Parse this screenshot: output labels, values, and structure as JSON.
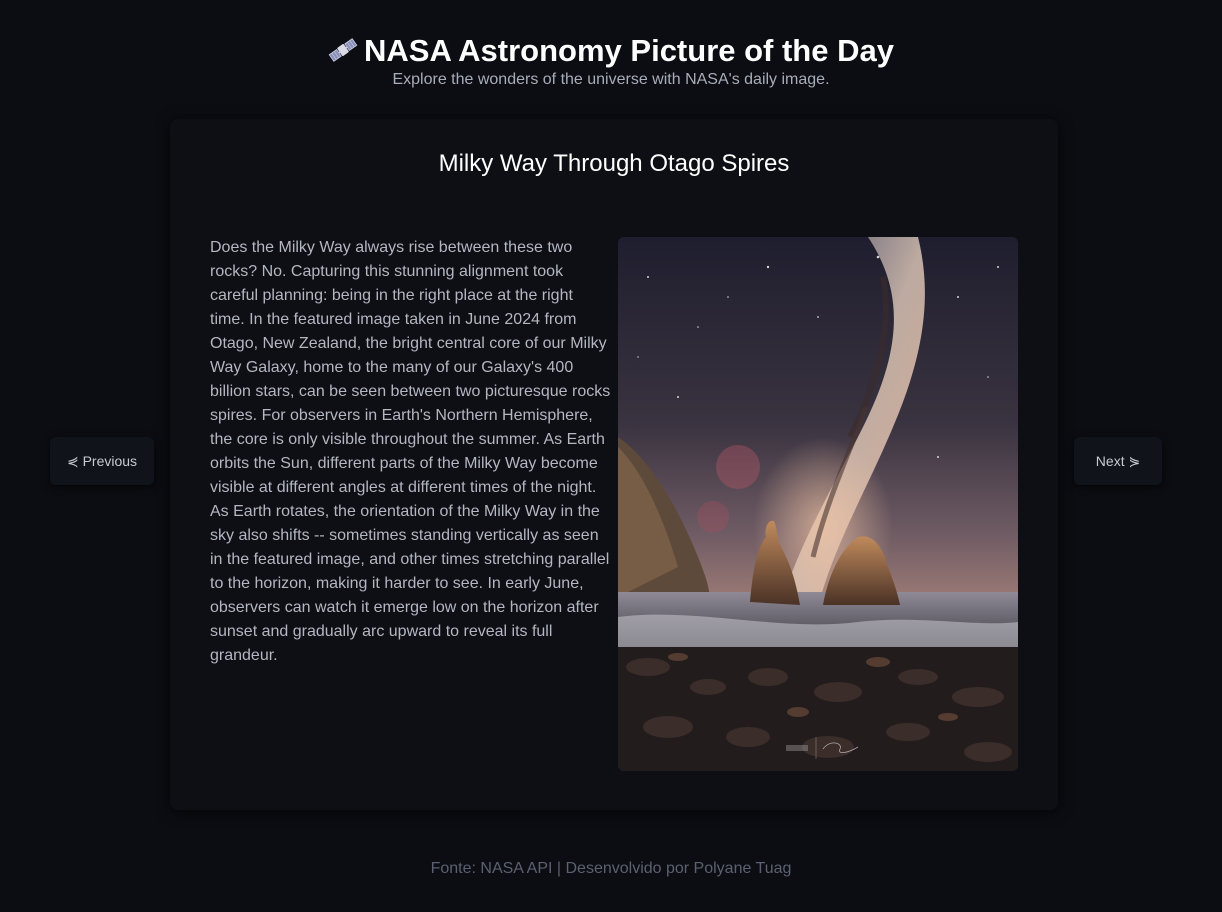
{
  "header": {
    "title": "NASA Astronomy Picture of the Day",
    "title_icon": "satellite-icon",
    "subtitle": "Explore the wonders of the universe with NASA's daily image."
  },
  "apod": {
    "title": "Milky Way Through Otago Spires",
    "explanation": "Does the Milky Way always rise between these two rocks? No. Capturing this stunning alignment took careful planning: being in the right place at the right time. In the featured image taken in June 2024 from Otago, New Zealand, the bright central core of our Milky Way Galaxy, home to the many of our Galaxy's 400 billion stars, can be seen between two picturesque rocks spires. For observers in Earth's Northern Hemisphere, the core is only visible throughout the summer. As Earth orbits the Sun, different parts of the Milky Way become visible at different angles at different times of the night. As Earth rotates, the orientation of the Milky Way in the sky also shifts -- sometimes standing vertically as seen in the featured image, and other times stretching parallel to the horizon, making it harder to see. In early June, observers can watch it emerge low on the horizon after sunset and gradually arc upward to reveal its full grandeur."
  },
  "navigation": {
    "previous_label": "⋞ Previous",
    "next_label": "Next ⋟"
  },
  "footer": {
    "text": "Fonte: NASA API | Desenvolvido por Polyane Tuag"
  },
  "colors": {
    "background": "#0b0d12",
    "card": "#0d0f14",
    "text_muted": "#b4b7c0",
    "footer_text": "#5c6070"
  }
}
